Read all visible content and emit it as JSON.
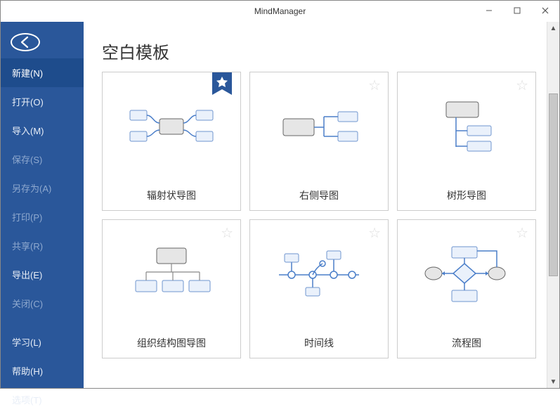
{
  "window": {
    "title": "MindManager"
  },
  "sidebar": {
    "items": [
      {
        "label": "新建(N)",
        "state": "active"
      },
      {
        "label": "打开(O)",
        "state": "normal"
      },
      {
        "label": "导入(M)",
        "state": "normal"
      },
      {
        "label": "保存(S)",
        "state": "disabled"
      },
      {
        "label": "另存为(A)",
        "state": "disabled"
      },
      {
        "label": "打印(P)",
        "state": "disabled"
      },
      {
        "label": "共享(R)",
        "state": "disabled"
      },
      {
        "label": "导出(E)",
        "state": "normal"
      },
      {
        "label": "关闭(C)",
        "state": "disabled"
      },
      {
        "label": "学习(L)",
        "state": "normal"
      },
      {
        "label": "帮助(H)",
        "state": "normal"
      },
      {
        "label": "选项(T)",
        "state": "normal"
      }
    ]
  },
  "main": {
    "section_title": "空白模板",
    "templates": [
      {
        "label": "辐射状导图",
        "featured": true,
        "diagram": "radial"
      },
      {
        "label": "右侧导图",
        "featured": false,
        "diagram": "right"
      },
      {
        "label": "树形导图",
        "featured": false,
        "diagram": "tree"
      },
      {
        "label": "组织结构图导图",
        "featured": false,
        "diagram": "org"
      },
      {
        "label": "时间线",
        "featured": false,
        "diagram": "timeline"
      },
      {
        "label": "流程图",
        "featured": false,
        "diagram": "flowchart"
      }
    ]
  },
  "colors": {
    "sidebar_bg": "#2a579a",
    "sidebar_active": "#1e4c8c",
    "accent": "#4a7ec9"
  }
}
